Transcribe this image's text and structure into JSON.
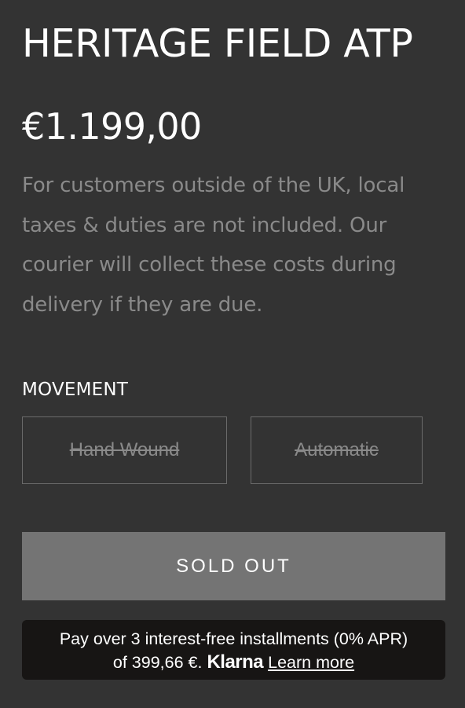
{
  "product": {
    "title": "HERITAGE FIELD ATP",
    "price": "€1.199,00",
    "tax_note": "For customers outside of the UK, local taxes & duties are not included. Our courier will collect these costs during delivery if they are due."
  },
  "movement": {
    "label": "MOVEMENT",
    "options": [
      {
        "label": "Hand Wound",
        "available": false
      },
      {
        "label": "Automatic",
        "available": false
      }
    ]
  },
  "cta": {
    "label": "SOLD OUT"
  },
  "klarna": {
    "line1": "Pay over 3 interest-free installments (0% APR)",
    "line2_prefix": "of 399,66 €.",
    "brand": "Klarna",
    "learn_more": "Learn more"
  },
  "colors": {
    "background": "#333333",
    "muted_text": "#8a8a8a",
    "button": "#747474",
    "klarna_bg": "#171514"
  }
}
